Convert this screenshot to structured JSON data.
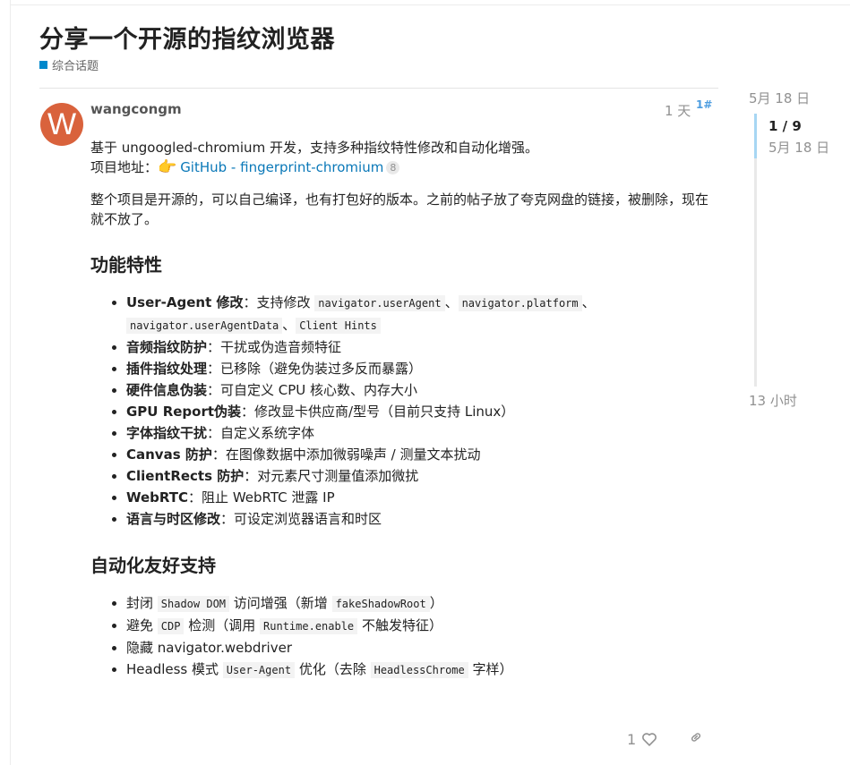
{
  "topic": {
    "title": "分享一个开源的指纹浏览器",
    "category": "综合话题"
  },
  "post": {
    "avatar_letter": "W",
    "username": "wangcongm",
    "date": "1 天",
    "edit_badge": "1",
    "intro": "基于 ungoogled-chromium 开发，支持多种指纹特性修改和自动化增强。",
    "project_label": "项目地址：",
    "project_link": "GitHub - fingerprint-chromium",
    "project_link_count": "8",
    "description": "整个项目是开源的，可以自己编译，也有打包好的版本。之前的帖子放了夸克网盘的链接，被删除，现在就不放了。",
    "features_heading": "功能特性",
    "features": {
      "ua_title": "User-Agent 修改",
      "ua_text": "：支持修改 ",
      "ua_code1": "navigator.userAgent",
      "ua_sep": "、",
      "ua_code2": "navigator.platform",
      "ua_code3": "navigator.userAgentData",
      "ua_code4": "Client Hints",
      "f2_title": "音频指纹防护",
      "f2_text": "：干扰或伪造音频特征",
      "f3_title": "插件指纹处理",
      "f3_text": "：已移除（避免伪装过多反而暴露）",
      "f4_title": "硬件信息伪装",
      "f4_text": "：可自定义 CPU 核心数、内存大小",
      "f5_title": "GPU Report伪装",
      "f5_text": "：修改显卡供应商/型号（目前只支持 Linux）",
      "f6_title": "字体指纹干扰",
      "f6_text": "：自定义系统字体",
      "f7_title": "Canvas 防护",
      "f7_text": "：在图像数据中添加微弱噪声 / 测量文本扰动",
      "f8_title": "ClientRects 防护",
      "f8_text": "：对元素尺寸测量值添加微扰",
      "f9_title": "WebRTC",
      "f9_text": "：阻止 WebRTC 泄露 IP",
      "f10_title": "语言与时区修改",
      "f10_text": "：可设定浏览器语言和时区"
    },
    "automation_heading": "自动化友好支持",
    "automation": {
      "a1_pre": "封闭 ",
      "a1_code1": "Shadow DOM",
      "a1_mid": " 访问增强（新增 ",
      "a1_code2": "fakeShadowRoot",
      "a1_post": "）",
      "a2_pre": "避免 ",
      "a2_code1": "CDP",
      "a2_mid": " 检测（调用 ",
      "a2_code2": "Runtime.enable",
      "a2_post": " 不触发特征）",
      "a3_text": "隐藏 navigator.webdriver",
      "a4_pre": "Headless 模式 ",
      "a4_code1": "User-Agent",
      "a4_mid": " 优化（去除 ",
      "a4_code2": "HeadlessChrome",
      "a4_post": " 字样）"
    },
    "like_count": "1"
  },
  "timeline": {
    "top_date": "5月 18 日",
    "progress": "1 / 9",
    "handle_date": "5月 18 日",
    "bottom_date": "13 小时",
    "position_fraction": 0.0
  },
  "colors": {
    "category": "#0088cc",
    "avatar": "#d9623c",
    "link": "#0a78b8",
    "timeline_handle": "#a7d6f3"
  }
}
